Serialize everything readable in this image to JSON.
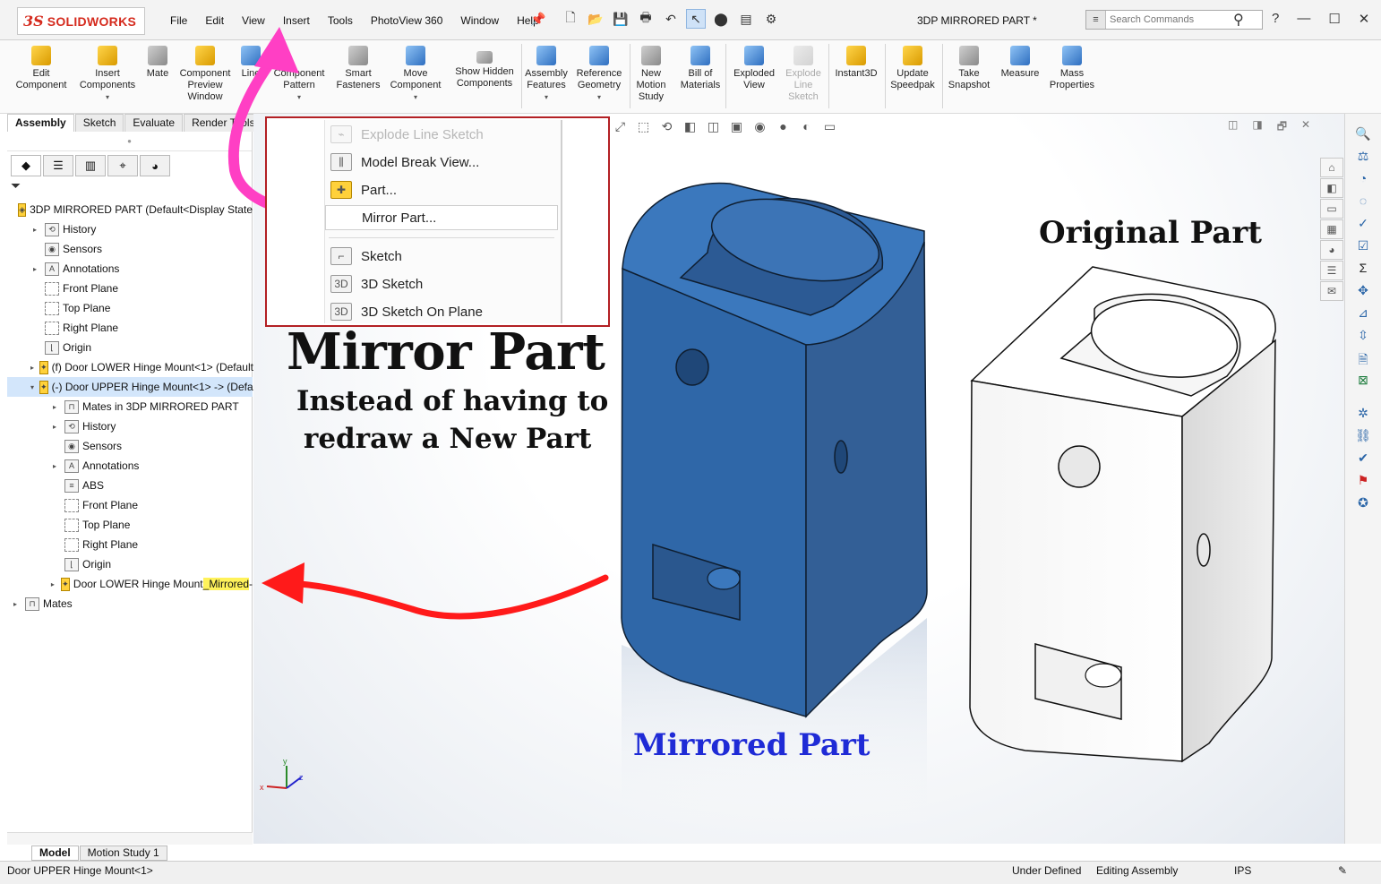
{
  "app": {
    "brand": "SOLIDWORKS",
    "brand_mark": "3S",
    "document_title": "3DP MIRRORED PART *"
  },
  "menu": [
    "File",
    "Edit",
    "View",
    "Insert",
    "Tools",
    "PhotoView 360",
    "Window",
    "Help"
  ],
  "search": {
    "placeholder": "Search Commands"
  },
  "command_manager": {
    "edit_component": "Edit Component",
    "insert_components": "Insert Components",
    "mate": "Mate",
    "component_preview": "Component Preview Window",
    "linear_pattern": "Line",
    "component_pattern": "Component Pattern",
    "smart_fasteners": "Smart Fasteners",
    "move_component": "Move Component",
    "show_hidden": "Show Hidden Components",
    "assembly_features": "Assembly Features",
    "reference_geometry": "Reference Geometry",
    "new_motion_study": "New Motion Study",
    "bill_of_materials": "Bill of Materials",
    "exploded_view": "Exploded View",
    "explode_line_sketch": "Explode Line Sketch",
    "instant3d": "Instant3D",
    "update_speedpak": "Update Speedpak",
    "take_snapshot": "Take Snapshot",
    "measure": "Measure",
    "mass_properties": "Mass Properties"
  },
  "command_tabs": [
    "Assembly",
    "Sketch",
    "Evaluate",
    "Render Tools"
  ],
  "feature_tree": [
    {
      "label": "3DP MIRRORED PART  (Default<Display State",
      "indent": 0,
      "icon": "assembly-icon",
      "exp": ""
    },
    {
      "label": "History",
      "indent": 1,
      "icon": "history-icon",
      "exp": "▸"
    },
    {
      "label": "Sensors",
      "indent": 1,
      "icon": "sensors-icon",
      "exp": ""
    },
    {
      "label": "Annotations",
      "indent": 1,
      "icon": "annotations-icon",
      "exp": "▸"
    },
    {
      "label": "Front Plane",
      "indent": 1,
      "icon": "plane-icon",
      "exp": ""
    },
    {
      "label": "Top Plane",
      "indent": 1,
      "icon": "plane-icon",
      "exp": ""
    },
    {
      "label": "Right Plane",
      "indent": 1,
      "icon": "plane-icon",
      "exp": ""
    },
    {
      "label": "Origin",
      "indent": 1,
      "icon": "origin-icon",
      "exp": ""
    },
    {
      "label": "(f) Door LOWER Hinge Mount<1> (Default",
      "indent": 1,
      "icon": "part-icon",
      "exp": "▸"
    },
    {
      "label": "(-) Door UPPER Hinge Mount<1> -> (Defa",
      "indent": 1,
      "icon": "part-icon",
      "exp": "▾",
      "selected": true
    },
    {
      "label": "Mates in 3DP MIRRORED PART",
      "indent": 2,
      "icon": "mates-icon",
      "exp": "▸"
    },
    {
      "label": "History",
      "indent": 2,
      "icon": "history-icon",
      "exp": "▸"
    },
    {
      "label": "Sensors",
      "indent": 2,
      "icon": "sensors-icon",
      "exp": ""
    },
    {
      "label": "Annotations",
      "indent": 2,
      "icon": "annotations-icon",
      "exp": "▸"
    },
    {
      "label": "ABS",
      "indent": 2,
      "icon": "material-icon",
      "exp": ""
    },
    {
      "label": "Front Plane",
      "indent": 2,
      "icon": "plane-icon",
      "exp": ""
    },
    {
      "label": "Top Plane",
      "indent": 2,
      "icon": "plane-icon",
      "exp": ""
    },
    {
      "label": "Right Plane",
      "indent": 2,
      "icon": "plane-icon",
      "exp": ""
    },
    {
      "label": "Origin",
      "indent": 2,
      "icon": "origin-icon",
      "exp": ""
    },
    {
      "label": "Door LOWER Hinge Mount",
      "label_hl": "_Mirrored",
      "label_tail": " -",
      "indent": 2,
      "icon": "part-icon",
      "exp": "▸"
    },
    {
      "label": "Mates",
      "indent": 0,
      "icon": "mates-icon",
      "exp": "▸"
    }
  ],
  "insert_menu": {
    "items": [
      {
        "label": "Explode Line Sketch",
        "icon": "explode-line-sketch-icon",
        "disabled": true
      },
      {
        "label": "Model Break View...",
        "icon": "model-break-view-icon"
      },
      {
        "label": "Part...",
        "icon": "part-icon"
      },
      {
        "label": "Mirror Part...",
        "icon": "mirror-part-icon",
        "hover": true
      },
      {
        "label": "Sketch",
        "icon": "sketch-icon"
      },
      {
        "label": "3D Sketch",
        "icon": "3d-sketch-icon"
      },
      {
        "label": "3D Sketch On Plane",
        "icon": "3d-sketch-on-plane-icon"
      }
    ]
  },
  "captions": {
    "main": "Mirror Part",
    "sub1": "Instead of having to",
    "sub2": "redraw a New Part",
    "mirrored": "Mirrored Part",
    "original": "Original Part"
  },
  "bottom_tabs": [
    "Model",
    "Motion Study 1"
  ],
  "status": {
    "selection": "Door UPPER Hinge Mount<1>",
    "defined": "Under Defined",
    "mode": "Editing Assembly",
    "units": "IPS"
  },
  "colors": {
    "mirrored_part": "#2f6fb5",
    "original_part": "#ffffff",
    "annotation_pink": "#ff3fc4",
    "annotation_red": "#ff1a1a",
    "menu_frame": "#b32024"
  }
}
